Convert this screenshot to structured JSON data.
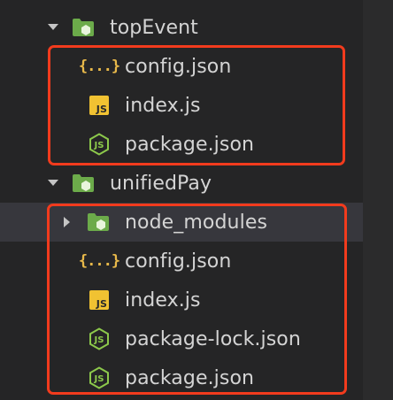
{
  "tree": {
    "folders": [
      {
        "name": "topEvent",
        "expanded": true,
        "children": [
          {
            "label": "config.json",
            "icon": "json-braces-icon"
          },
          {
            "label": "index.js",
            "icon": "js-file-icon"
          },
          {
            "label": "package.json",
            "icon": "nodejs-icon"
          }
        ]
      },
      {
        "name": "unifiedPay",
        "expanded": true,
        "children": [
          {
            "label": "node_modules",
            "icon": "node-folder-icon",
            "collapsed": true
          },
          {
            "label": "config.json",
            "icon": "json-braces-icon"
          },
          {
            "label": "index.js",
            "icon": "js-file-icon"
          },
          {
            "label": "package-lock.json",
            "icon": "nodejs-icon"
          },
          {
            "label": "package.json",
            "icon": "nodejs-icon"
          }
        ]
      }
    ],
    "js_badge": "JS",
    "json_badge": "{...}"
  },
  "colors": {
    "background": "#252526",
    "text": "#d4d4d4",
    "highlight_border": "#f23b1d",
    "folder_green": "#6cab4a",
    "node_green": "#8cc84b",
    "js_yellow": "#f1c232",
    "json_yellow": "#e8b94a"
  }
}
